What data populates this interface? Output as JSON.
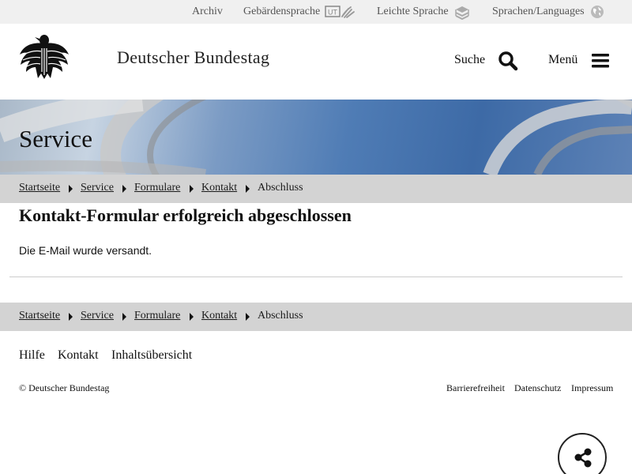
{
  "topbar": {
    "archive": "Archiv",
    "sign_language": "Gebärdensprache",
    "easy_language": "Leichte Sprache",
    "languages": "Sprachen/Languages"
  },
  "header": {
    "title": "Deutscher Bundestag",
    "search_label": "Suche",
    "menu_label": "Menü"
  },
  "banner": {
    "title": "Service"
  },
  "breadcrumb": [
    "Startseite",
    "Service",
    "Formulare",
    "Kontakt",
    "Abschluss"
  ],
  "content": {
    "heading": "Kontakt-Formular erfolgreich abgeschlossen",
    "message": "Die E-Mail wurde versandt."
  },
  "footer": {
    "links": [
      "Hilfe",
      "Kontakt",
      "Inhaltsübersicht"
    ],
    "copyright": "© Deutscher Bundestag",
    "legal": [
      "Barrierefreiheit",
      "Datenschutz",
      "Impressum"
    ]
  },
  "icons": {
    "sign_language": "ut-hands-icon",
    "easy_language": "book-stack-icon",
    "languages": "globe-icon",
    "search": "magnifier-icon",
    "menu": "hamburger-icon",
    "share": "share-icon",
    "logo": "federal-eagle-logo"
  }
}
